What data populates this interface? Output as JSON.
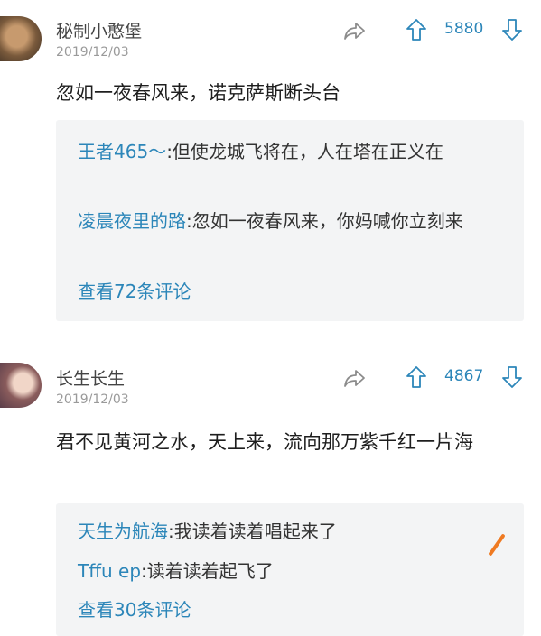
{
  "comments": [
    {
      "username": "秘制小憨堡",
      "date": "2019/12/03",
      "votes": "5880",
      "content": "忽如一夜春风来，诺克萨斯断头台",
      "replies": [
        {
          "name": "王者465～",
          "text": ":但使龙城飞将在，人在塔在正义在"
        },
        {
          "name": "凌晨夜里的路",
          "text": ":忽如一夜春风来，你妈喊你立刻来"
        }
      ],
      "view_more": "查看72条评论"
    },
    {
      "username": "长生长生",
      "date": "2019/12/03",
      "votes": "4867",
      "content": "君不见黄河之水，天上来，流向那万紫千红一片海",
      "replies": [
        {
          "name": "天生为航海",
          "text": ":我读着读着唱起来了"
        },
        {
          "name": "Tffu ep",
          "text": ":读着读着起飞了"
        }
      ],
      "view_more": "查看30条评论"
    }
  ],
  "icons": {
    "share": "share-icon",
    "upvote": "upvote-icon",
    "downvote": "downvote-icon"
  },
  "colors": {
    "accent": "#2c86b9",
    "reply_bg": "#f3f4f5",
    "muted": "#9a9a9a"
  }
}
